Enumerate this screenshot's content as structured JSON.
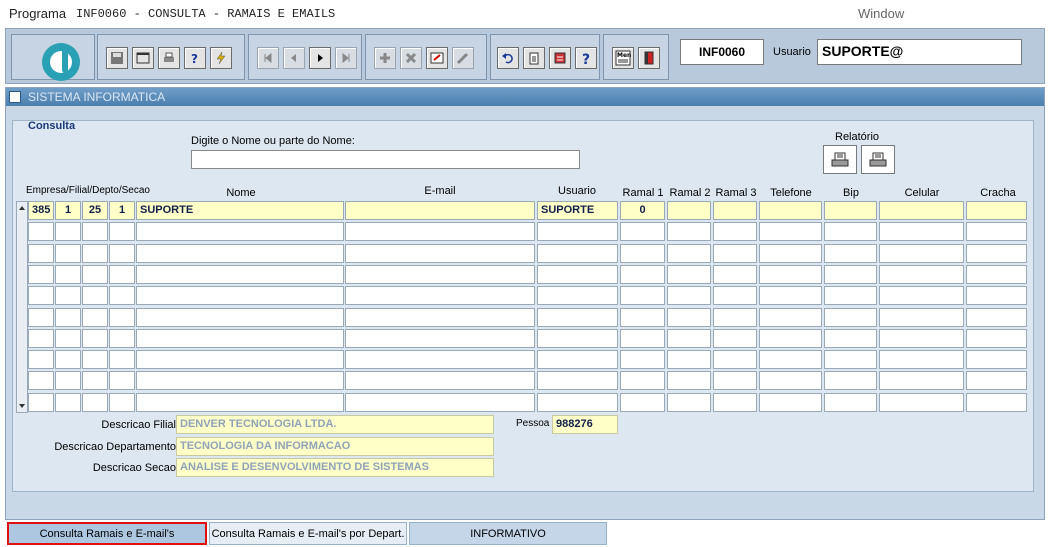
{
  "menubar": {
    "programa": "Programa",
    "program_title": "INF0060 - CONSULTA - RAMAIS E EMAILS",
    "window": "Window"
  },
  "toolbar": {
    "program_code": "INF0060",
    "user_label": "Usuario",
    "user_value": "SUPORTE@"
  },
  "system": {
    "title": "SISTEMA INFORMATICA"
  },
  "form": {
    "section_title": "Consulta",
    "search_label": "Digite o Nome ou parte do Nome:",
    "search_value": "",
    "report_label": "Relatório"
  },
  "table": {
    "headers": {
      "empresa": "Empresa/Filial/Depto/Secao",
      "nome": "Nome",
      "email": "E-mail",
      "usuario": "Usuario",
      "ramal1": "Ramal 1",
      "ramal2": "Ramal 2",
      "ramal3": "Ramal 3",
      "telefone": "Telefone",
      "bip": "Bip",
      "celular": "Celular",
      "cracha": "Cracha"
    },
    "rows": [
      {
        "empresa": "385",
        "filial": "1",
        "depto": "25",
        "secao": "1",
        "nome": "SUPORTE",
        "email": "",
        "usuario": "SUPORTE",
        "ramal1": "0",
        "ramal2": "",
        "ramal3": "",
        "telefone": "",
        "bip": "",
        "celular": "",
        "cracha": ""
      }
    ],
    "empty_rows": 9
  },
  "details": {
    "filial_label": "Descricao Filial",
    "filial_value": "DENVER TECNOLOGIA LTDA.",
    "depto_label": "Descricao Departamento",
    "depto_value": "TECNOLOGIA DA INFORMACAO",
    "secao_label": "Descricao Secao",
    "secao_value": "ANALISE E DESENVOLVIMENTO DE SISTEMAS",
    "pessoa_label": "Pessoa",
    "pessoa_value": "988276"
  },
  "tabs": [
    {
      "label": "Consulta Ramais e E-mail's"
    },
    {
      "label": "Consulta Ramais e E-mail's por Depart."
    },
    {
      "label": "INFORMATIVO"
    }
  ]
}
